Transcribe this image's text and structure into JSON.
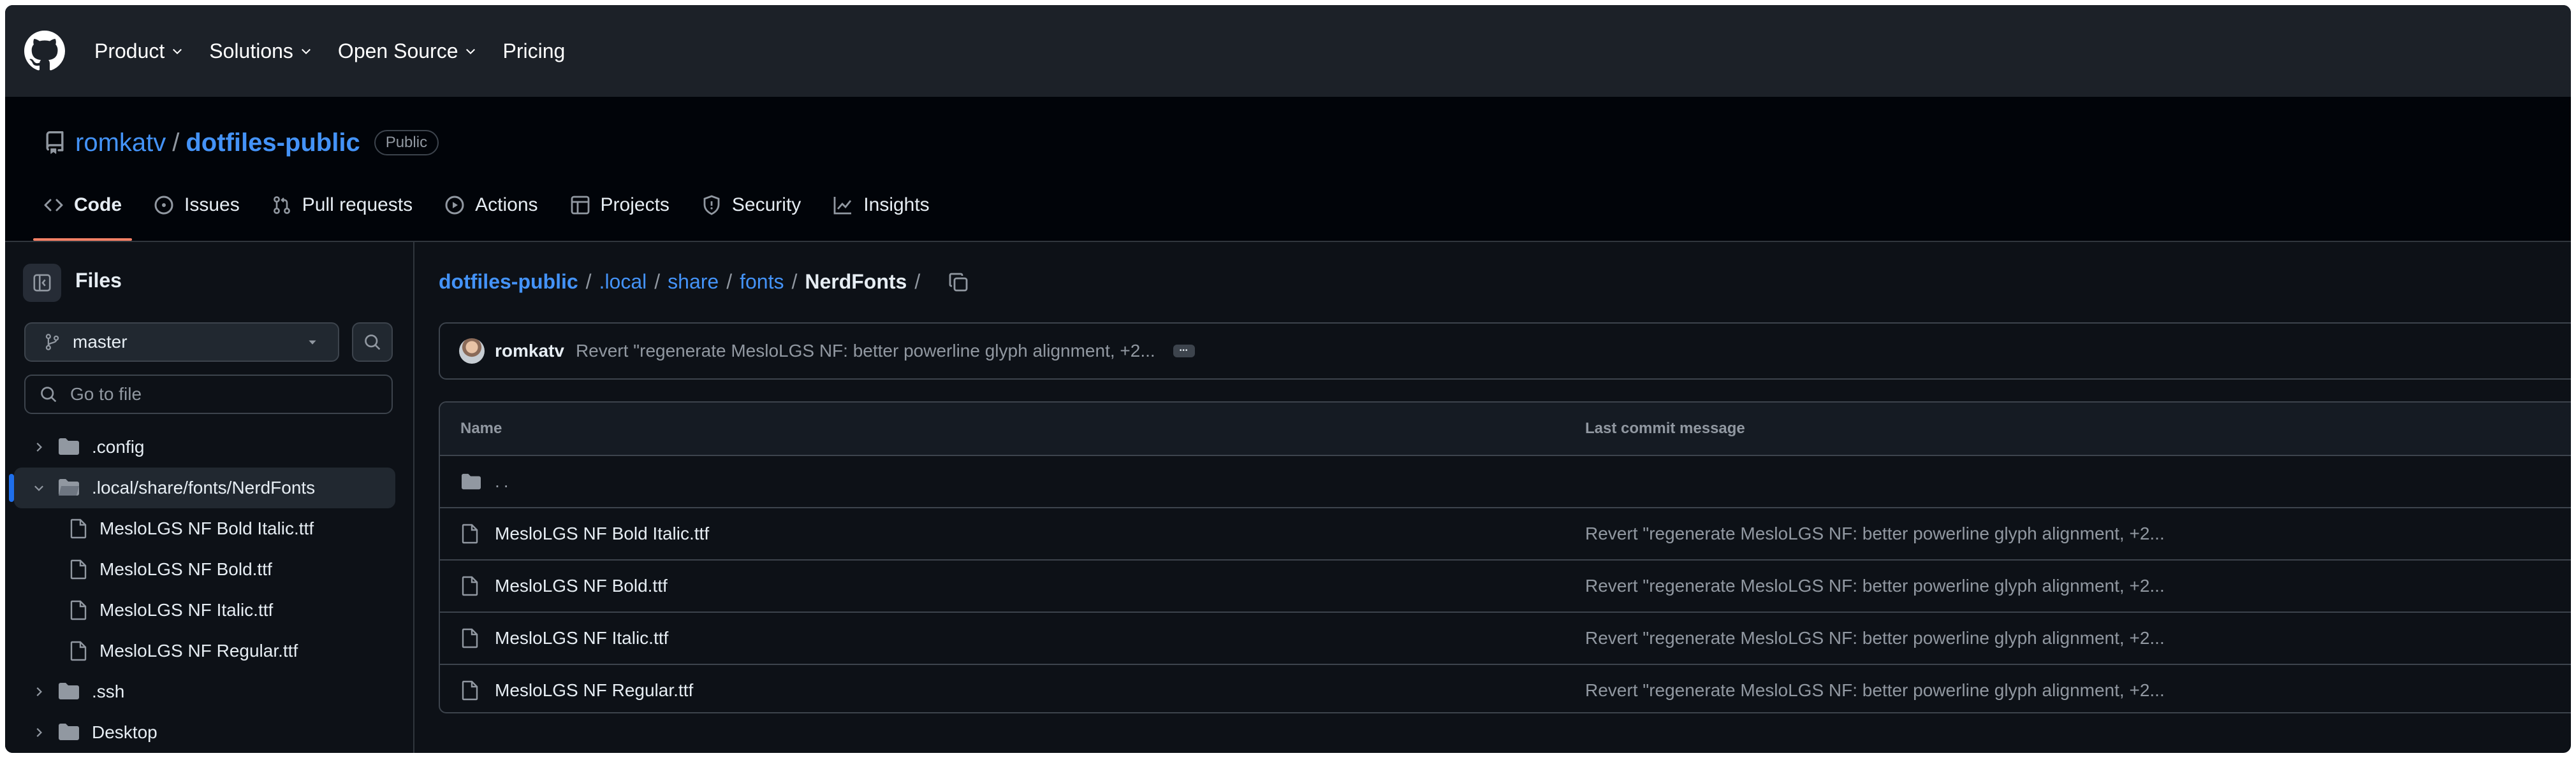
{
  "global_nav": {
    "items": [
      {
        "label": "Product",
        "has_menu": true
      },
      {
        "label": "Solutions",
        "has_menu": true
      },
      {
        "label": "Open Source",
        "has_menu": true
      },
      {
        "label": "Pricing",
        "has_menu": false
      }
    ]
  },
  "repo": {
    "owner": "romkatv",
    "separator": "/",
    "name": "dotfiles-public",
    "visibility": "Public"
  },
  "repo_tabs": [
    {
      "label": "Code",
      "icon": "code-icon",
      "active": true
    },
    {
      "label": "Issues",
      "icon": "issue-icon"
    },
    {
      "label": "Pull requests",
      "icon": "pull-request-icon"
    },
    {
      "label": "Actions",
      "icon": "play-icon"
    },
    {
      "label": "Projects",
      "icon": "table-icon"
    },
    {
      "label": "Security",
      "icon": "shield-icon"
    },
    {
      "label": "Insights",
      "icon": "graph-icon"
    }
  ],
  "sidebar": {
    "title": "Files",
    "branch": "master",
    "goto_placeholder": "Go to file",
    "tree": [
      {
        "label": ".config",
        "type": "folder",
        "expanded": false
      },
      {
        "label": ".local/share/fonts/NerdFonts",
        "type": "folder",
        "expanded": true,
        "selected": true
      },
      {
        "label": "MesloLGS NF Bold Italic.ttf",
        "type": "file"
      },
      {
        "label": "MesloLGS NF Bold.ttf",
        "type": "file"
      },
      {
        "label": "MesloLGS NF Italic.ttf",
        "type": "file"
      },
      {
        "label": "MesloLGS NF Regular.ttf",
        "type": "file"
      },
      {
        "label": ".ssh",
        "type": "folder",
        "expanded": false
      },
      {
        "label": "Desktop",
        "type": "folder",
        "expanded": false
      }
    ]
  },
  "breadcrumb": {
    "parts": [
      "dotfiles-public",
      ".local",
      "share",
      "fonts"
    ],
    "current": "NerdFonts",
    "separator": "/"
  },
  "latest_commit": {
    "author": "romkatv",
    "message": "Revert \"regenerate MesloLGS NF: better powerline glyph alignment, +2...",
    "ellipsis": "•••"
  },
  "file_table": {
    "headers": {
      "name": "Name",
      "message": "Last commit message"
    },
    "parent_label": "..",
    "rows": [
      {
        "name": "MesloLGS NF Bold Italic.ttf",
        "message": "Revert \"regenerate MesloLGS NF: better powerline glyph alignment, +2..."
      },
      {
        "name": "MesloLGS NF Bold.ttf",
        "message": "Revert \"regenerate MesloLGS NF: better powerline glyph alignment, +2..."
      },
      {
        "name": "MesloLGS NF Italic.ttf",
        "message": "Revert \"regenerate MesloLGS NF: better powerline glyph alignment, +2..."
      },
      {
        "name": "MesloLGS NF Regular.ttf",
        "message": "Revert \"regenerate MesloLGS NF: better powerline glyph alignment, +2..."
      }
    ]
  },
  "colors": {
    "background": "#0d1117",
    "header": "#1c2128",
    "link": "#4493f8",
    "muted": "#9198a1",
    "active_tab_underline": "#f78166",
    "selected_indicator": "#1f6feb"
  }
}
